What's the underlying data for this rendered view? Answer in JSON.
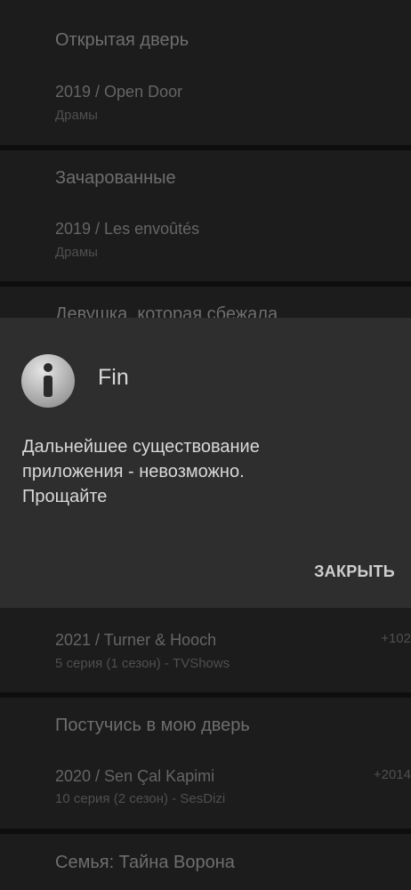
{
  "list": {
    "items": [
      {
        "title": "Открытая дверь",
        "subtitle": "2019 / Open Door",
        "meta": "Драмы",
        "extra": ""
      },
      {
        "title": "Зачарованные",
        "subtitle": "2019 / Les envoûtés",
        "meta": "Драмы",
        "extra": ""
      },
      {
        "title": "Девушка, которая сбежала",
        "subtitle": "",
        "meta": "",
        "extra": ""
      },
      {
        "title": "",
        "subtitle": "2021 / Turner & Hooch",
        "meta": "5 серия (1 сезон) - TVShows",
        "extra": "+102"
      },
      {
        "title": "Постучись в мою дверь",
        "subtitle": "2020 / Sen Çal Kapimi",
        "meta": "10 серия (2 сезон) - SesDizi",
        "extra": "+2014"
      },
      {
        "title": "Семья: Тайна Ворона",
        "subtitle": "",
        "meta": "",
        "extra": ""
      }
    ]
  },
  "dialog": {
    "icon": "info-icon",
    "title": "Fin",
    "message": "Дальнейшее существование\nприложения - невозможно.\nПрощайте",
    "close_label": "ЗАКРЫТЬ"
  }
}
